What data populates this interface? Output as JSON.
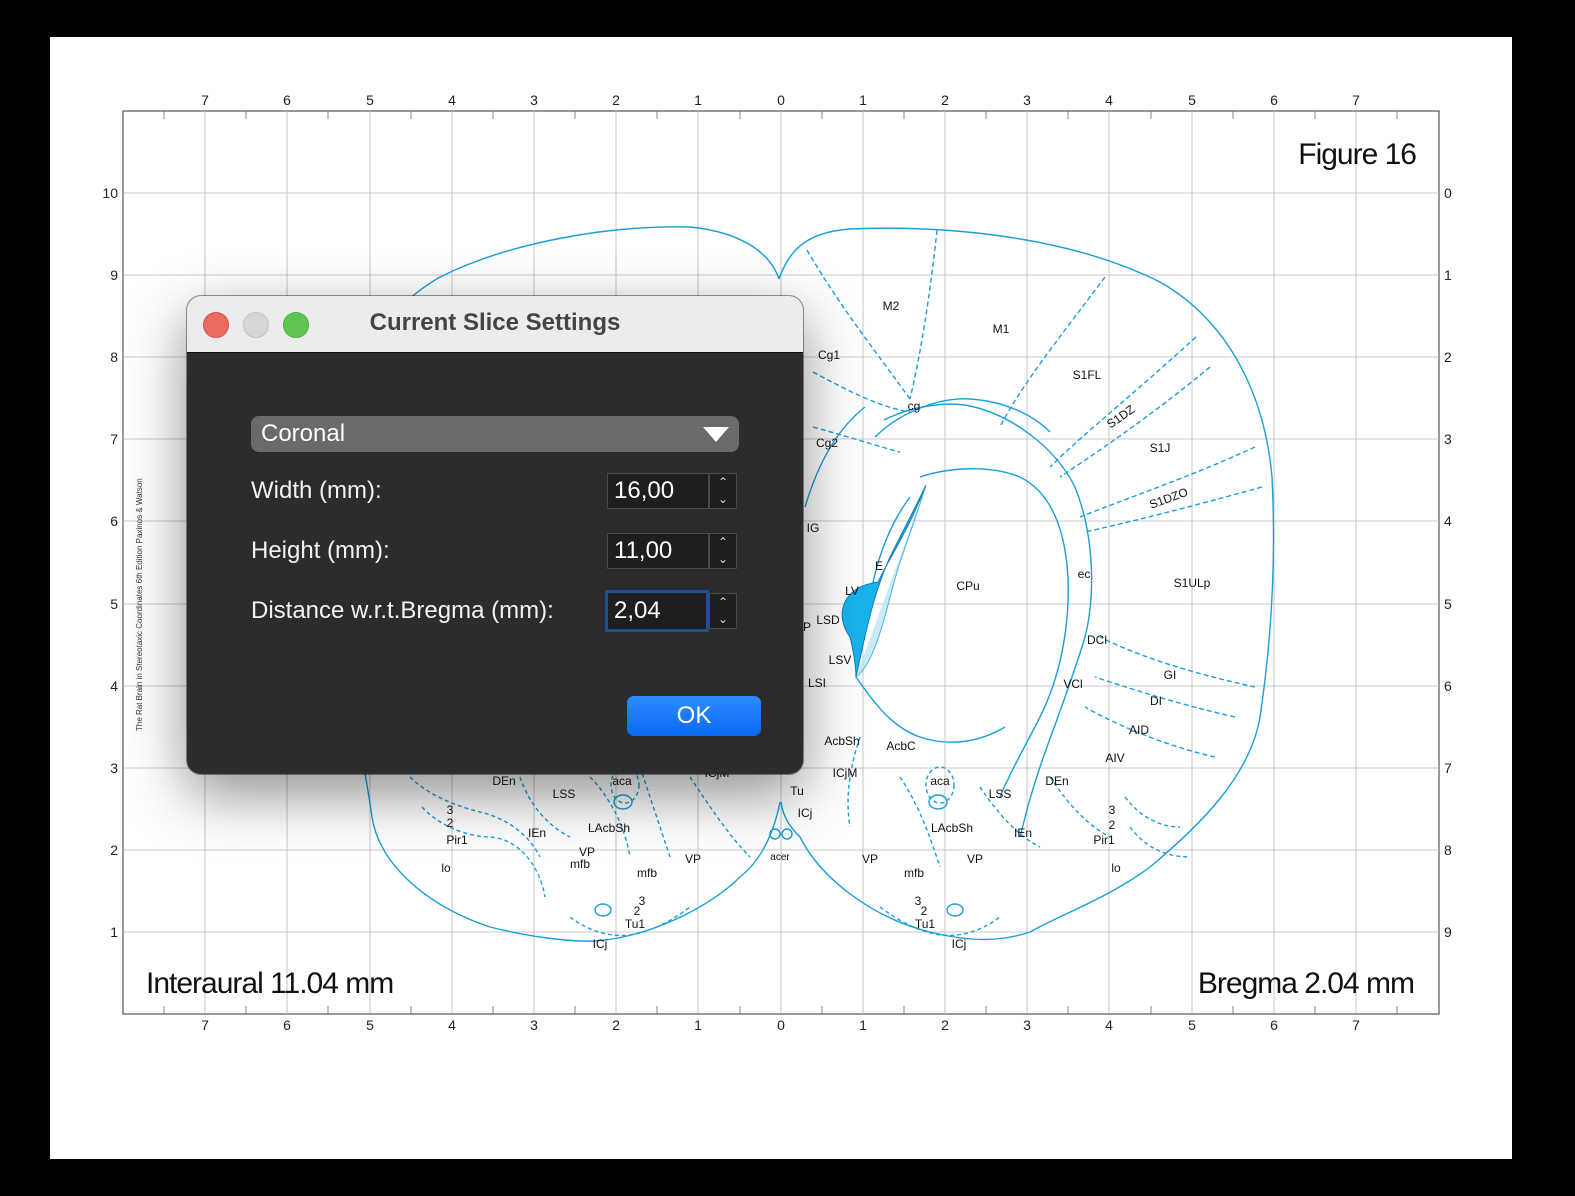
{
  "atlas": {
    "figure_label": "Figure 16",
    "interaural_label": "Interaural 11.04 mm",
    "bregma_label": "Bregma 2.04 mm",
    "side_credit": "The Rat Brain in Stereotaxic Coordinates 6th Edition Paxinos & Watson",
    "top_ticks": [
      "7",
      "6",
      "5",
      "4",
      "3",
      "2",
      "1",
      "0",
      "1",
      "2",
      "3",
      "4",
      "5",
      "6",
      "7"
    ],
    "bottom_ticks": [
      "7",
      "6",
      "5",
      "4",
      "3",
      "2",
      "1",
      "0",
      "1",
      "2",
      "3",
      "4",
      "5",
      "6",
      "7"
    ],
    "left_ticks": [
      "10",
      "9",
      "8",
      "7",
      "6",
      "5",
      "4",
      "3",
      "2",
      "1"
    ],
    "right_ticks": [
      "0",
      "1",
      "2",
      "3",
      "4",
      "5",
      "6",
      "7",
      "8",
      "9"
    ],
    "regions": {
      "M2": "M2",
      "M1": "M1",
      "S1FL": "S1FL",
      "S1DZ": "S1DZ",
      "S1J": "S1J",
      "S1DZO": "S1DZO",
      "S1ULp": "S1ULp",
      "Cg1": "Cg1",
      "Cg2": "Cg2",
      "cg": "cg",
      "IG": "IG",
      "E": "E",
      "LV": "LV",
      "CPu": "CPu",
      "ec": "ec",
      "LSD": "LSD",
      "LSV": "LSV",
      "LSI": "LSI",
      "DCl": "DCl",
      "VCl": "VCl",
      "GI": "GI",
      "DI": "DI",
      "AID": "AID",
      "AIV": "AIV",
      "AcbSh": "AcbSh",
      "AcbC": "AcbC",
      "ICjM": "ICjM",
      "aca": "aca",
      "LSS": "LSS",
      "DEn": "DEn",
      "Tu": "Tu",
      "ICj": "ICj",
      "LAcbSh": "LAcbSh",
      "IEn": "IEn",
      "three": "3",
      "two": "2",
      "Pir1": "Pir1",
      "VP": "VP",
      "mfb": "mfb",
      "lo": "lo",
      "acer": "acer",
      "Tu1": "Tu1",
      "ICj_small": "ICjM",
      "P": "P"
    }
  },
  "dialog": {
    "title": "Current Slice Settings",
    "orientation": "Coronal",
    "width_label": "Width (mm):",
    "width_value": "16,00",
    "height_label": "Height (mm):",
    "height_value": "11,00",
    "distance_label": "Distance w.r.t.Bregma (mm):",
    "distance_value": "2,04",
    "ok_label": "OK",
    "stepper_up": "⌃",
    "stepper_down": "⌄"
  },
  "colors": {
    "atlas_line": "#1a9fd8",
    "ventricle_fill": "#1ab2ec",
    "close": "#ed6a5e",
    "minimize": "#d7d7d7",
    "zoom": "#61c554",
    "accent": "#0a6af0"
  }
}
